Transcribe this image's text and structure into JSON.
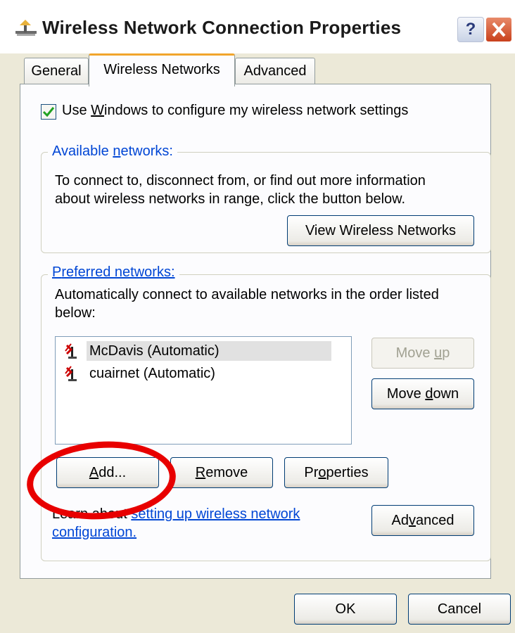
{
  "window": {
    "title": "Wireless Network Connection Properties",
    "help_label": "?"
  },
  "tabs": [
    {
      "label": "General"
    },
    {
      "label": "Wireless Networks",
      "active": true
    },
    {
      "label": "Advanced"
    }
  ],
  "use_windows": {
    "checked": true,
    "label_pre": "Use ",
    "label_u": "W",
    "label_post": "indows to configure my wireless network settings"
  },
  "available": {
    "legend_pre": "Available ",
    "legend_u": "n",
    "legend_post": "etworks:",
    "line1": "To connect to, disconnect from, or find out more information",
    "line2": "about wireless networks in range, click the button below.",
    "view_button": "View Wireless Networks"
  },
  "preferred": {
    "legend_u": "P",
    "legend_post": "referred networks:",
    "line1": "Automatically connect to available networks in the order listed",
    "line2": "below:",
    "networks": [
      {
        "name": "McDavis (Automatic)",
        "selected": true
      },
      {
        "name": "cuairnet (Automatic)",
        "selected": false
      }
    ],
    "move_up_pre": "Move ",
    "move_up_u": "u",
    "move_up_post": "p",
    "move_down_pre": "Move ",
    "move_down_u": "d",
    "move_down_post": "own",
    "add_u": "A",
    "add_post": "dd...",
    "remove_u": "R",
    "remove_post": "emove",
    "properties_pre": "Pr",
    "properties_u": "o",
    "properties_post": "perties",
    "learn_pre": "Learn about ",
    "learn_link": "setting up wireless network",
    "learn_link2": "configuration.",
    "advanced_pre": "Ad",
    "advanced_u": "v",
    "advanced_post": "anced"
  },
  "footer": {
    "ok": "OK",
    "cancel": "Cancel"
  },
  "colors": {
    "dialog_bg": "#ece9d8",
    "panel_bg": "#fcfcfe",
    "legend_blue": "#0046d5",
    "tab_active_accent": "#f1a52c",
    "annotation_red": "#e80000"
  }
}
